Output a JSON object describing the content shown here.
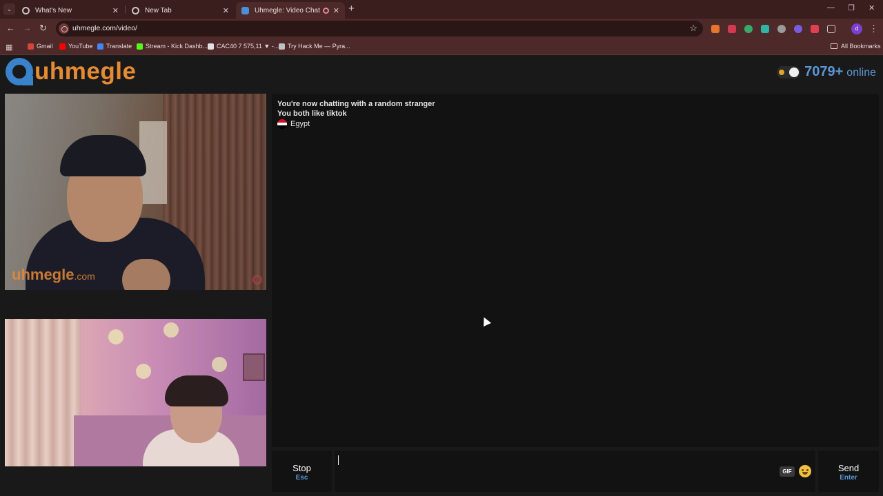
{
  "browser": {
    "tabs": [
      {
        "title": "What's New",
        "active": false
      },
      {
        "title": "New Tab",
        "active": false
      },
      {
        "title": "Uhmegle: Video Chat | Om",
        "active": true
      }
    ],
    "url": "uhmegle.com/video/",
    "profile_initial": "d",
    "bookmarks": [
      {
        "label": "Gmail",
        "icon": "gmail-icon",
        "color": "#d44638"
      },
      {
        "label": "YouTube",
        "icon": "youtube-icon",
        "color": "#ff0000"
      },
      {
        "label": "Translate",
        "icon": "translate-icon",
        "color": "#4285f4"
      },
      {
        "label": "Stream - Kick Dashb...",
        "icon": "kick-icon",
        "color": "#53fc18"
      },
      {
        "label": "CAC40 7 575,11 ▼ -...",
        "icon": "tradingview-icon",
        "color": "#e0e0e0"
      },
      {
        "label": "Try Hack Me — Pyra...",
        "icon": "tryhackme-icon",
        "color": "#c0c0c0"
      }
    ],
    "all_bookmarks": "All Bookmarks"
  },
  "site": {
    "logo_text": "uhmegle",
    "online_count": "7079+",
    "online_label": "online",
    "watermark": "uhmegle",
    "watermark_suffix": ".com",
    "accent_orange": "#e68a34",
    "accent_blue": "#5d97d6"
  },
  "chat": {
    "line1": "You're now chatting with a random stranger",
    "line2": "You both like tiktok",
    "country": "Egypt",
    "flag_colors": [
      "#ce1126",
      "#ffffff",
      "#000000"
    ]
  },
  "controls": {
    "stop_label": "Stop",
    "stop_hint": "Esc",
    "send_label": "Send",
    "send_hint": "Enter",
    "gif_label": "GIF",
    "message_value": ""
  }
}
